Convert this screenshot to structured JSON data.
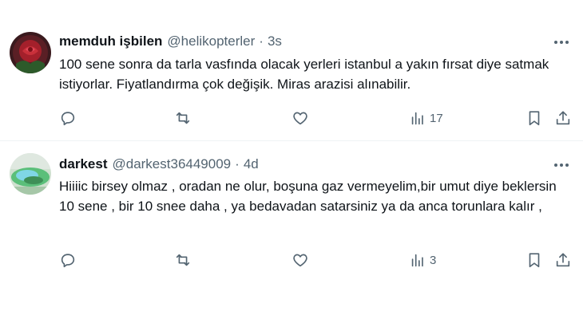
{
  "tweets": [
    {
      "name": "memduh işbilen",
      "handle": "@helikopterler",
      "separator": "·",
      "time": "3s",
      "text": "100 sene sonra da tarla vasfında olacak yerleri istanbul a yakın fırsat diye satmak istiyorlar. Fiyatlandırma çok değişik. Miras arazisi alınabilir.",
      "views": "17"
    },
    {
      "name": "darkest",
      "handle": "@darkest36449009",
      "separator": "·",
      "time": "4d",
      "text": "Hiiiic birsey olmaz , oradan ne olur, boşuna gaz vermeyelim,bir umut diye beklersin 10 sene , bir 10 snee daha , ya bedavadan satarsiniz ya da anca torunlara kalır ,",
      "views": "3"
    }
  ],
  "icons": {
    "more": "more-horizontal-icon",
    "reply": "reply-icon",
    "retweet": "retweet-icon",
    "like": "heart-icon",
    "views": "analytics-icon",
    "bookmark": "bookmark-icon",
    "share": "share-icon"
  },
  "colors": {
    "text": "#0f1419",
    "secondary": "#536471",
    "divider": "#eff3f4"
  }
}
